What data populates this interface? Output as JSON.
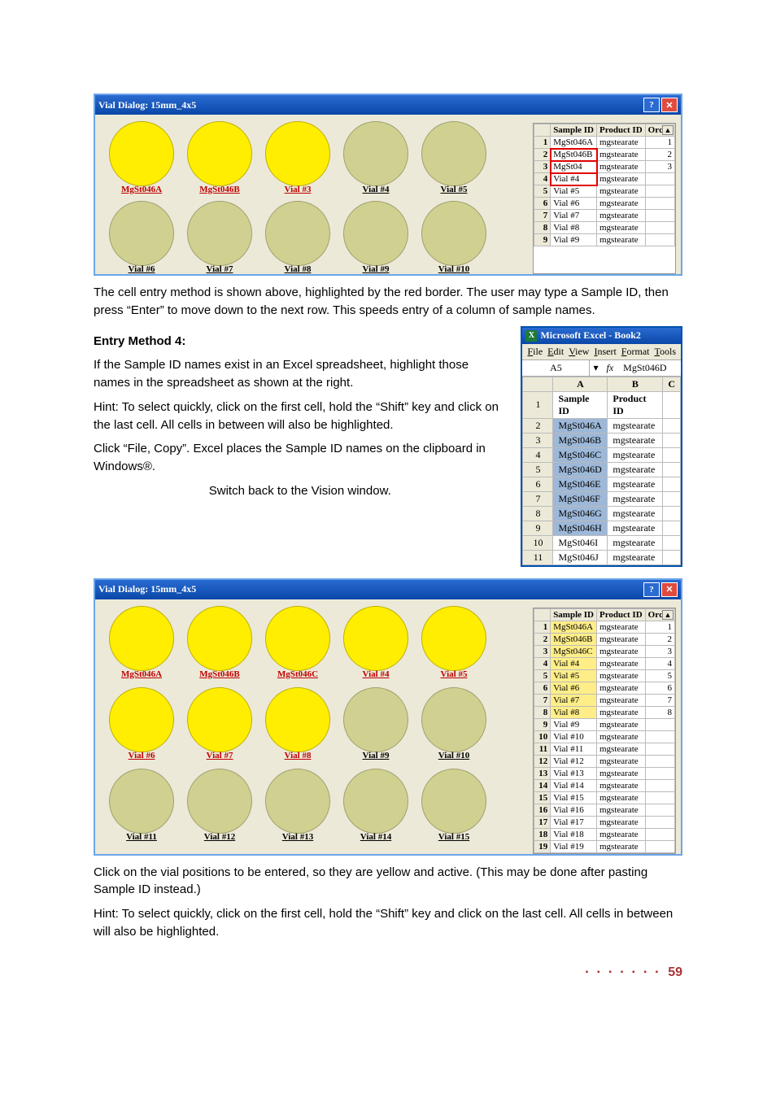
{
  "fig1": {
    "title": "Vial Dialog: 15mm_4x5",
    "vials_row1": [
      {
        "label": "MgSt046A",
        "sel": true
      },
      {
        "label": "MgSt046B",
        "sel": true
      },
      {
        "label": "Vial #3",
        "sel": true
      },
      {
        "label": "Vial #4",
        "sel": false
      },
      {
        "label": "Vial #5",
        "sel": false
      }
    ],
    "vials_row2": [
      {
        "label": "Vial #6",
        "sel": false
      },
      {
        "label": "Vial #7",
        "sel": false
      },
      {
        "label": "Vial #8",
        "sel": false
      },
      {
        "label": "Vial #9",
        "sel": false
      },
      {
        "label": "Vial #10",
        "sel": false
      }
    ],
    "headers": [
      "",
      "Sample ID",
      "Product ID",
      "Order"
    ],
    "rows": [
      {
        "n": "1",
        "s": "MgSt046A",
        "p": "mgstearate",
        "o": "1",
        "red": false
      },
      {
        "n": "2",
        "s": "MgSt046B",
        "p": "mgstearate",
        "o": "2",
        "red": true
      },
      {
        "n": "3",
        "s": "MgSt04",
        "p": "mgstearate",
        "o": "3",
        "red": true
      },
      {
        "n": "4",
        "s": "Vial #4",
        "p": "mgstearate",
        "o": "",
        "red": true
      },
      {
        "n": "5",
        "s": "Vial #5",
        "p": "mgstearate",
        "o": "",
        "red": false
      },
      {
        "n": "6",
        "s": "Vial #6",
        "p": "mgstearate",
        "o": "",
        "red": false
      },
      {
        "n": "7",
        "s": "Vial #7",
        "p": "mgstearate",
        "o": "",
        "red": false
      },
      {
        "n": "8",
        "s": "Vial #8",
        "p": "mgstearate",
        "o": "",
        "red": false
      },
      {
        "n": "9",
        "s": "Vial #9",
        "p": "mgstearate",
        "o": "",
        "red": false
      }
    ]
  },
  "para1": "The cell entry method is shown above, highlighted by the red border. The user may type a Sample ID, then press “Enter” to move down to the next row. This speeds entry of a column of sample names.",
  "h_entry4": "Entry Method 4:",
  "para2": "If the Sample ID names exist in an Excel spreadsheet, highlight those names in the spreadsheet as shown at the right.",
  "para3": "Hint: To select quickly, click on the first cell, hold the “Shift” key and click on the last cell. All cells in between will also be highlighted.",
  "para4": "Click “File, Copy”. Excel places the Sample ID names on the clipboard in Windows®.",
  "para5": "Switch back to the Vision window.",
  "excel": {
    "title": "Microsoft Excel - Book2",
    "menu": [
      "File",
      "Edit",
      "View",
      "Insert",
      "Format",
      "Tools"
    ],
    "namebox": "A5",
    "fx": "fx",
    "fxval": "MgSt046D",
    "cols": [
      "",
      "A",
      "B",
      "C"
    ],
    "rows": [
      {
        "n": "1",
        "a": "Sample ID",
        "b": "Product ID",
        "bold": true
      },
      {
        "n": "2",
        "a": "MgSt046A",
        "b": "mgstearate",
        "sel": true
      },
      {
        "n": "3",
        "a": "MgSt046B",
        "b": "mgstearate",
        "sel": true
      },
      {
        "n": "4",
        "a": "MgSt046C",
        "b": "mgstearate",
        "sel": true
      },
      {
        "n": "5",
        "a": "MgSt046D",
        "b": "mgstearate",
        "sel": true
      },
      {
        "n": "6",
        "a": "MgSt046E",
        "b": "mgstearate",
        "sel": true
      },
      {
        "n": "7",
        "a": "MgSt046F",
        "b": "mgstearate",
        "sel": true
      },
      {
        "n": "8",
        "a": "MgSt046G",
        "b": "mgstearate",
        "sel": true
      },
      {
        "n": "9",
        "a": "MgSt046H",
        "b": "mgstearate",
        "sel": true
      },
      {
        "n": "10",
        "a": "MgSt046I",
        "b": "mgstearate"
      },
      {
        "n": "11",
        "a": "MgSt046J",
        "b": "mgstearate"
      }
    ]
  },
  "fig2": {
    "title": "Vial Dialog: 15mm_4x5",
    "rows": [
      [
        {
          "label": "MgSt046A",
          "sel": true
        },
        {
          "label": "MgSt046B",
          "sel": true
        },
        {
          "label": "MgSt046C",
          "sel": true
        },
        {
          "label": "Vial #4",
          "sel": true
        },
        {
          "label": "Vial #5",
          "sel": true
        }
      ],
      [
        {
          "label": "Vial #6",
          "sel": true
        },
        {
          "label": "Vial #7",
          "sel": true
        },
        {
          "label": "Vial #8",
          "sel": true
        },
        {
          "label": "Vial #9",
          "sel": false
        },
        {
          "label": "Vial #10",
          "sel": false
        }
      ],
      [
        {
          "label": "Vial #11",
          "sel": false
        },
        {
          "label": "Vial #12",
          "sel": false
        },
        {
          "label": "Vial #13",
          "sel": false
        },
        {
          "label": "Vial #14",
          "sel": false
        },
        {
          "label": "Vial #15",
          "sel": false
        }
      ]
    ],
    "headers": [
      "",
      "Sample ID",
      "Product ID",
      "Order"
    ],
    "trows": [
      {
        "n": "1",
        "s": "MgSt046A",
        "p": "mgstearate",
        "o": "1",
        "sel": true
      },
      {
        "n": "2",
        "s": "MgSt046B",
        "p": "mgstearate",
        "o": "2",
        "sel": true
      },
      {
        "n": "3",
        "s": "MgSt046C",
        "p": "mgstearate",
        "o": "3",
        "sel": true
      },
      {
        "n": "4",
        "s": "Vial #4",
        "p": "mgstearate",
        "o": "4",
        "sel": true
      },
      {
        "n": "5",
        "s": "Vial #5",
        "p": "mgstearate",
        "o": "5",
        "sel": true
      },
      {
        "n": "6",
        "s": "Vial #6",
        "p": "mgstearate",
        "o": "6",
        "sel": true
      },
      {
        "n": "7",
        "s": "Vial #7",
        "p": "mgstearate",
        "o": "7",
        "sel": true
      },
      {
        "n": "8",
        "s": "Vial #8",
        "p": "mgstearate",
        "o": "8",
        "sel": true
      },
      {
        "n": "9",
        "s": "Vial #9",
        "p": "mgstearate",
        "o": ""
      },
      {
        "n": "10",
        "s": "Vial #10",
        "p": "mgstearate",
        "o": ""
      },
      {
        "n": "11",
        "s": "Vial #11",
        "p": "mgstearate",
        "o": ""
      },
      {
        "n": "12",
        "s": "Vial #12",
        "p": "mgstearate",
        "o": ""
      },
      {
        "n": "13",
        "s": "Vial #13",
        "p": "mgstearate",
        "o": ""
      },
      {
        "n": "14",
        "s": "Vial #14",
        "p": "mgstearate",
        "o": ""
      },
      {
        "n": "15",
        "s": "Vial #15",
        "p": "mgstearate",
        "o": ""
      },
      {
        "n": "16",
        "s": "Vial #16",
        "p": "mgstearate",
        "o": ""
      },
      {
        "n": "17",
        "s": "Vial #17",
        "p": "mgstearate",
        "o": ""
      },
      {
        "n": "18",
        "s": "Vial #18",
        "p": "mgstearate",
        "o": ""
      },
      {
        "n": "19",
        "s": "Vial #19",
        "p": "mgstearate",
        "o": ""
      }
    ]
  },
  "para6": "Click on the vial positions to be entered, so they are yellow and active. (This may be done after pasting Sample ID instead.)",
  "para7": "Hint: To select quickly, click on the first cell, hold the “Shift” key and click on the last cell. All cells in between will also be highlighted.",
  "pagenum": "59",
  "dots": "▪ ▪ ▪ ▪ ▪ ▪ ▪"
}
